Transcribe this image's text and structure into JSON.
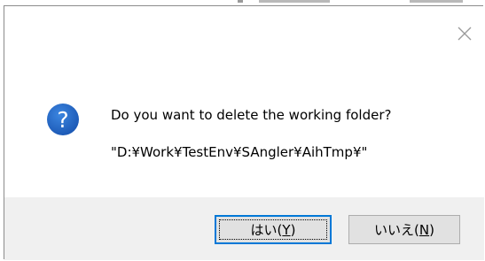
{
  "dialog": {
    "message": "Do you want to delete the working folder?",
    "path": "\"D:¥Work¥TestEnv¥SAngler¥AihTmp¥\"",
    "icon": "question-icon",
    "close_icon": "close-icon"
  },
  "buttons": {
    "yes": {
      "label": "はい(",
      "accel": "Y",
      "suffix": ")"
    },
    "no": {
      "label": "いいえ(",
      "accel": "N",
      "suffix": ")"
    }
  },
  "colors": {
    "icon_blue": "#1f5fbf",
    "primary_border": "#0078d7",
    "footer_bg": "#f0f0f0",
    "button_bg": "#e1e1e1"
  }
}
